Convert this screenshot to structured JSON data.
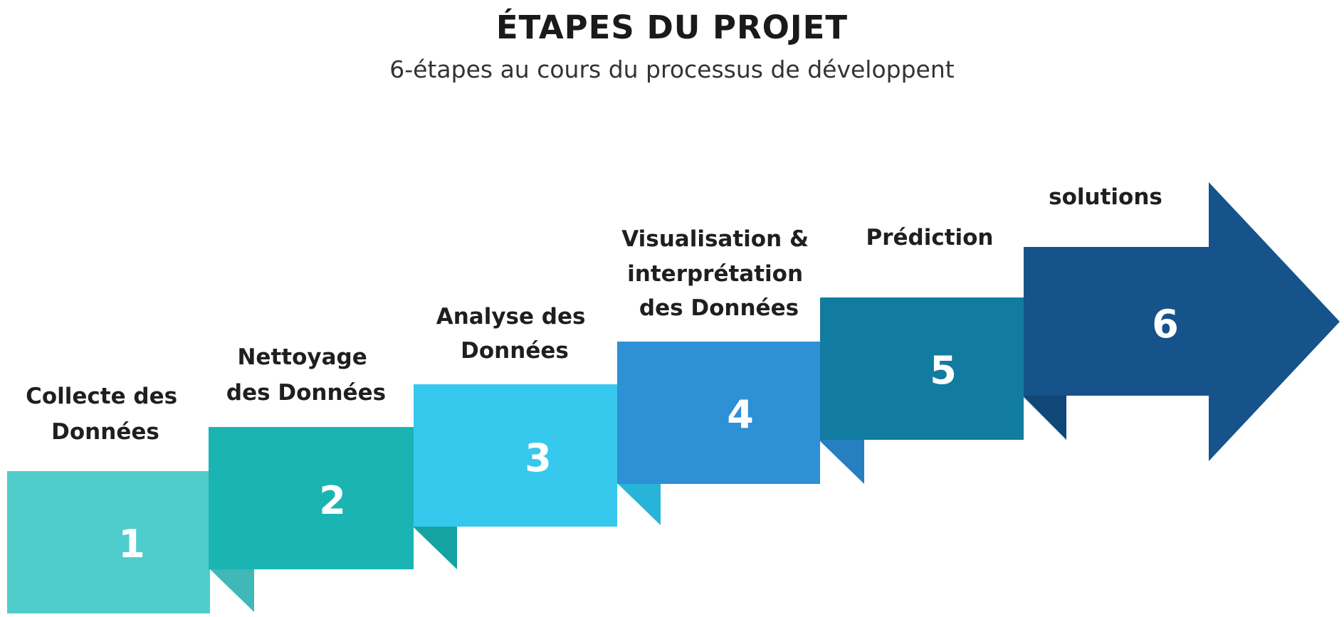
{
  "header": {
    "title": "ÉTAPES DU PROJET",
    "subtitle": "6-étapes au cours du processus de développent"
  },
  "steps": [
    {
      "number": "1",
      "label_lines": [
        "Collecte des",
        "Données"
      ],
      "color": "#4ECDCC",
      "fold_color": "#3FB8B7"
    },
    {
      "number": "2",
      "label_lines": [
        "Nettoyage",
        "des Données"
      ],
      "color": "#1AB5B3",
      "fold_color": "#14A3A1"
    },
    {
      "number": "3",
      "label_lines": [
        "Analyse des",
        "Données"
      ],
      "color": "#37C8EE",
      "fold_color": "#28B3D8"
    },
    {
      "number": "4",
      "label_lines": [
        "Visualisation &",
        "interprétation",
        "des Données"
      ],
      "color": "#2E90D5",
      "fold_color": "#2680C0"
    },
    {
      "number": "5",
      "label_lines": [
        "Prédiction"
      ],
      "color": "#127BA0",
      "fold_color": "#0F6B8C"
    },
    {
      "number": "6",
      "label_lines": [
        "solutions"
      ],
      "color": "#15538A",
      "fold_color": "#104678"
    }
  ]
}
